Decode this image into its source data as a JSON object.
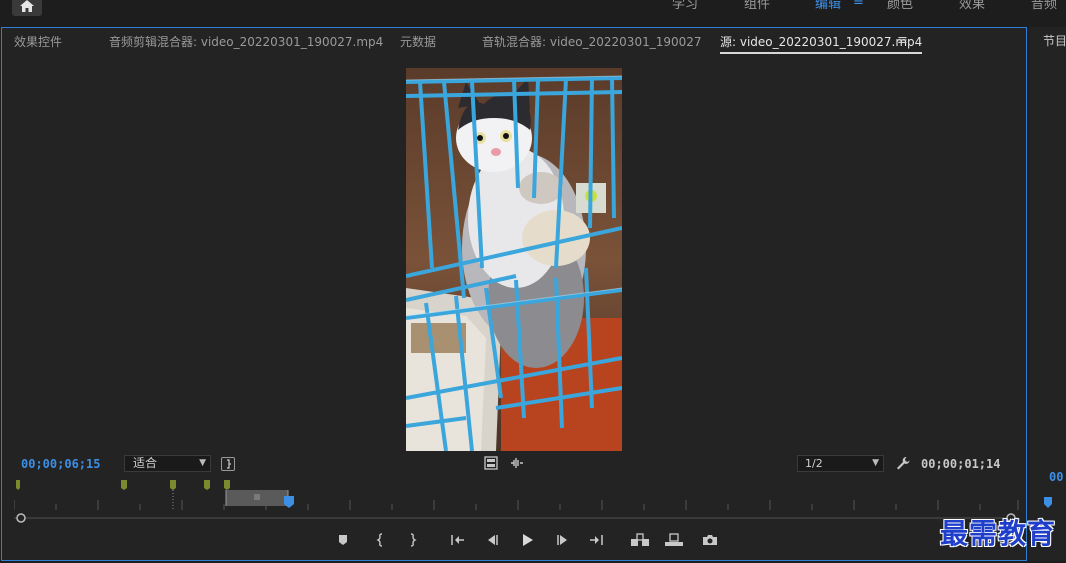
{
  "workspace": {
    "items": [
      {
        "label": "学习",
        "active": false
      },
      {
        "label": "组件",
        "active": false
      },
      {
        "label": "编辑",
        "active": true
      },
      {
        "label": "颜色",
        "active": false
      },
      {
        "label": "效果",
        "active": false
      },
      {
        "label": "音频",
        "active": false
      }
    ],
    "menu_glyph": "≡"
  },
  "source_panel": {
    "tabs": [
      {
        "label": "效果控件",
        "active": false
      },
      {
        "label": "音频剪辑混合器: video_20220301_190027.mp4",
        "active": false
      },
      {
        "label": "元数据",
        "active": false
      },
      {
        "label": "音轨混合器: video_20220301_190027",
        "active": false
      },
      {
        "label": "源: video_20220301_190027.mp4",
        "active": true
      }
    ],
    "tab_menu_glyph": "≡",
    "playhead_timecode": "00;00;06;15",
    "zoom_select": "适合",
    "resolution_select": "1/2",
    "duration_timecode": "00;00;01;14"
  },
  "program_panel": {
    "tab_label": "节目",
    "timecode": "00"
  },
  "watermark": "最需教育",
  "colors": {
    "accent_blue": "#3d8fe6",
    "panel_bg": "#232323",
    "marker_green": "#6b7a2a"
  }
}
